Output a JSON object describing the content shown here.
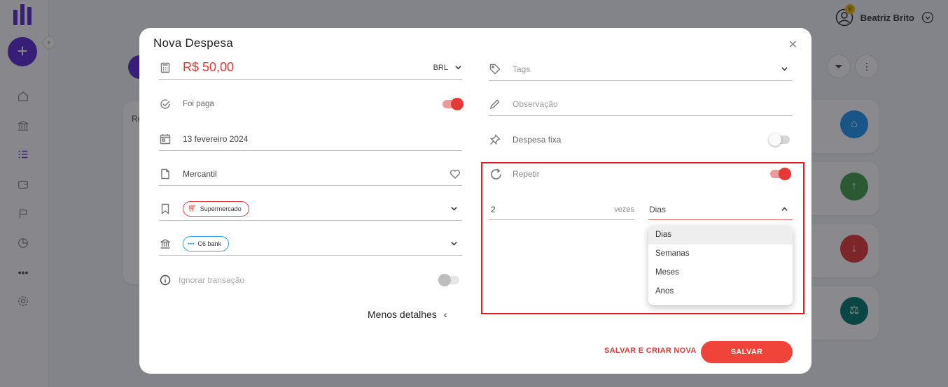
{
  "user": {
    "name": "Beatriz Brito"
  },
  "background": {
    "card_label_fragment": "Re"
  },
  "modal": {
    "title": "Nova Despesa",
    "amount": "R$ 50,00",
    "currency": "BRL",
    "paid_label": "Foi paga",
    "date": "13 fevereiro 2024",
    "description": "Mercantil",
    "category": "Supermercado",
    "account": "C6 bank",
    "ignore_label": "Ignorar transação",
    "less_details": "Menos detalhes",
    "tags_placeholder": "Tags",
    "note_placeholder": "Observação",
    "fixed_label": "Despesa fixa",
    "repeat_label": "Repetir",
    "repeat_count": "2",
    "times_label": "vezes",
    "period_selected": "Dias",
    "period_options": [
      "Dias",
      "Semanas",
      "Meses",
      "Anos"
    ],
    "save_new_label": "SALVAR E CRIAR NOVA",
    "save_label": "SALVAR"
  },
  "colors": {
    "accent": "#e53935",
    "brand": "#5b2bd1",
    "highlight": "#e31b23"
  }
}
